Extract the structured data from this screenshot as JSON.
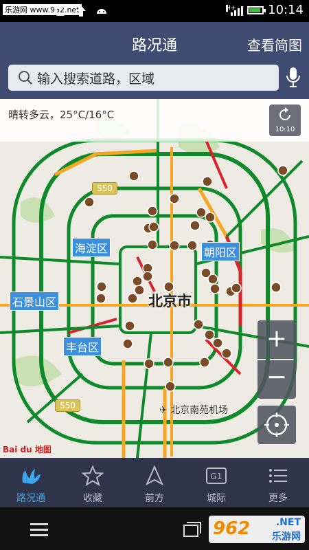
{
  "status_bar": {
    "carrier_tag": "乐游网 www.962.net",
    "time": "10:14",
    "network": "H+"
  },
  "header": {
    "title": "路况通",
    "overview_button": "查看简图"
  },
  "search": {
    "placeholder": "输入搜索道路，区域"
  },
  "map": {
    "weather": "晴转多云，25°C/16°C",
    "refresh_time": "10:10",
    "district_labels": [
      "海淀区",
      "朝阳区",
      "石景山区",
      "丰台区"
    ],
    "center_label": "北京市",
    "airport_label": "北京南苑机场",
    "road_shields": [
      "S50",
      "S50"
    ],
    "zoom_in": "+",
    "zoom_out": "−",
    "brand": "Bai du 地图",
    "colors": {
      "congested": "#d8232a",
      "slow": "#f6a623",
      "smooth": "#0e8a2a"
    }
  },
  "tabs": [
    {
      "label": "路况通",
      "icon": "traffic-hand-icon",
      "active": true
    },
    {
      "label": "收藏",
      "icon": "star-icon",
      "active": false
    },
    {
      "label": "前方",
      "icon": "arrow-up-icon",
      "active": false
    },
    {
      "label": "城际",
      "icon": "highway-g1-icon",
      "active": false
    },
    {
      "label": "更多",
      "icon": "list-icon",
      "active": false
    }
  ],
  "highway_badge": "G1",
  "watermark": {
    "logo": "962",
    "net": ".NET",
    "site": "乐游网"
  }
}
